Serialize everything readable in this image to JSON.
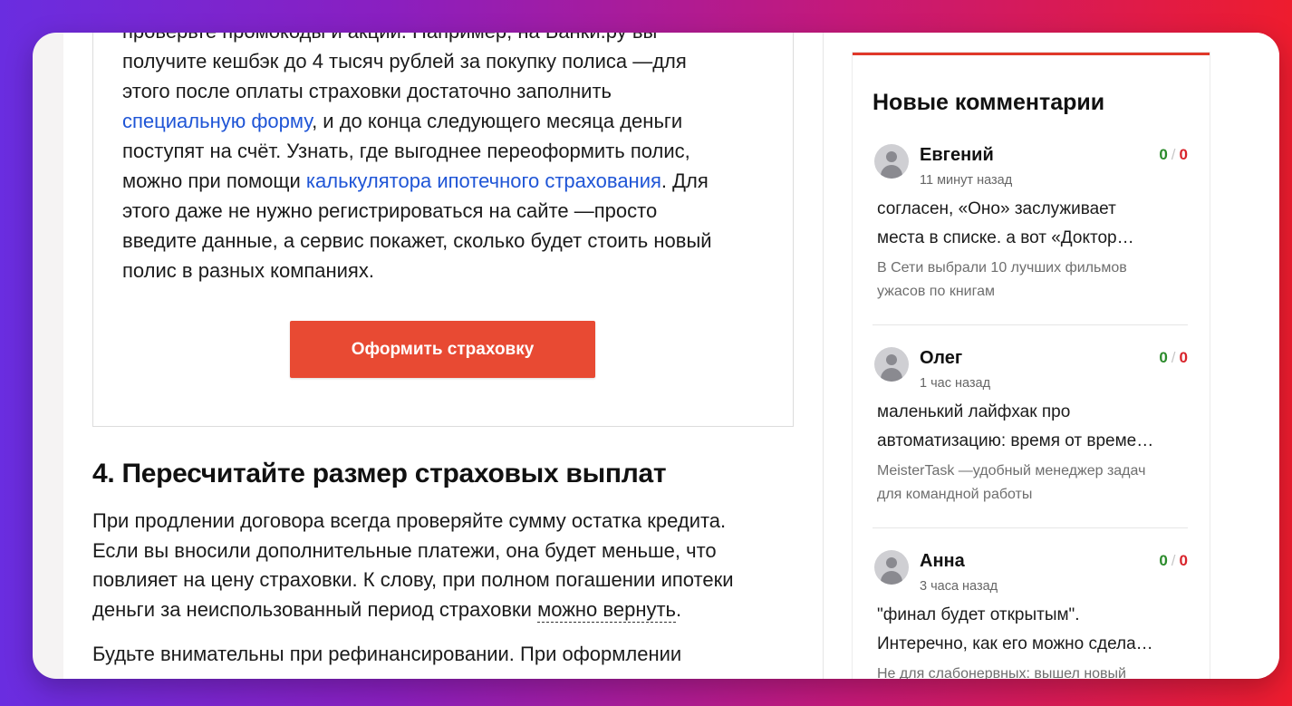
{
  "article": {
    "promo_lines": [
      "проверьте промокоды и акции. Например, на Банки.ру вы",
      "получите кешбэк до 4 тысяч рублей за покупку полиса —для",
      "этого после оплаты страховки достаточно заполнить"
    ],
    "promo_link1": "специальную форму",
    "promo_after_link1": ", и до конца следующего месяца деньги",
    "promo_line5": "поступят на счёт. Узнать, где выгоднее переоформить полис,",
    "promo_before_link2": "можно при помощи ",
    "promo_link2": "калькулятора ипотечного страхования",
    "promo_after_link2": ". Для",
    "promo_lines_tail": [
      "этого даже не нужно регистрироваться на сайте —просто",
      "введите данные, а сервис покажет, сколько будет стоить новый",
      "полис в разных компаниях."
    ],
    "cta_label": "Оформить страховку",
    "section_heading": "4. Пересчитайте размер страховых выплат",
    "para1_lines": [
      "При продлении договора всегда проверяйте сумму остатка кредита.",
      "Если вы вносили дополнительные платежи, она будет меньше, что",
      "повлияет на цену страховки. К слову, при полном погашении ипотеки"
    ],
    "para1_last_before": "деньги за неиспользованный период страховки ",
    "para1_link": "можно вернуть",
    "para1_last_after": ".",
    "para2": "Будьте внимательны при рефинансировании. При оформлении"
  },
  "sidebar": {
    "title": "Новые комментарии",
    "comments": [
      {
        "name": "Евгений",
        "time": "11 минут назад",
        "votes_up": "0",
        "votes_sep": "/",
        "votes_down": "0",
        "text_lines": [
          "согласен, «Оно» заслуживает",
          "места в списке. а вот «Доктор…"
        ],
        "article_lines": [
          "В Сети выбрали 10 лучших фильмов",
          "ужасов по книгам"
        ]
      },
      {
        "name": "Олег",
        "time": "1 час назад",
        "votes_up": "0",
        "votes_sep": "/",
        "votes_down": "0",
        "text_lines": [
          "маленький лайфхак про",
          "автоматизацию: время от време…"
        ],
        "article_lines": [
          "MeisterTask —удобный менеджер задач",
          "для командной работы"
        ]
      },
      {
        "name": "Анна",
        "time": "3 часа назад",
        "votes_up": "0",
        "votes_sep": "/",
        "votes_down": "0",
        "text_lines": [
          "\"финал будет открытым\".",
          "Интеречно, как его можно сдела…"
        ],
        "article_lines": [
          "Не для слабонервных: вышел новый",
          ""
        ]
      }
    ]
  },
  "colors": {
    "accent_red": "#e84a33",
    "link_blue": "#1f55d6",
    "vote_up_green": "#2a8a2a",
    "vote_down_red": "#d8232a"
  }
}
